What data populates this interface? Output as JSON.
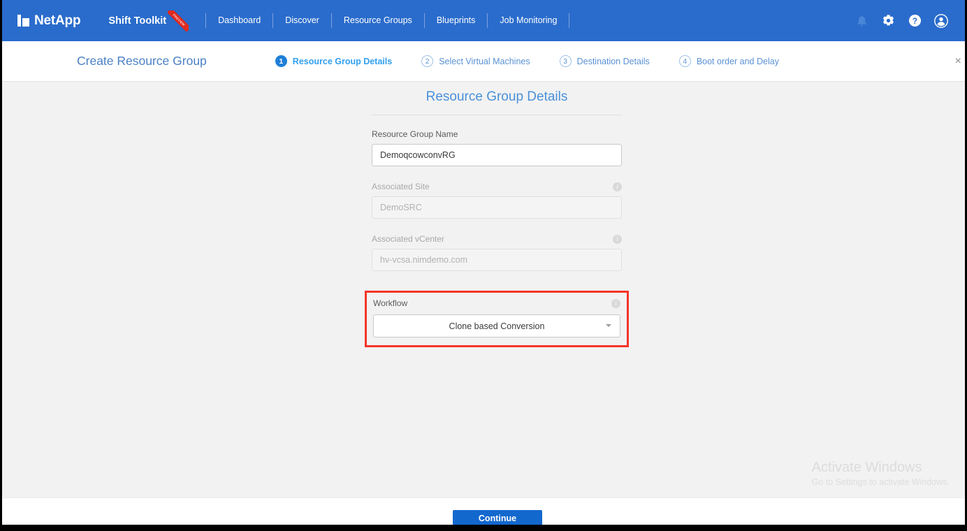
{
  "topnav": {
    "brand": "NetApp",
    "product": "Shift Toolkit",
    "ribbon_text": "PREVIEW",
    "links": [
      {
        "label": "Dashboard"
      },
      {
        "label": "Discover"
      },
      {
        "label": "Resource Groups"
      },
      {
        "label": "Blueprints"
      },
      {
        "label": "Job Monitoring"
      }
    ],
    "icons": [
      {
        "name": "bell-icon"
      },
      {
        "name": "gear-icon"
      },
      {
        "name": "help-icon"
      },
      {
        "name": "user-avatar-icon"
      }
    ],
    "background_color": "#2a6ccc"
  },
  "wizard": {
    "title": "Create Resource Group",
    "close_label": "×",
    "steps": [
      {
        "num": "1",
        "label": "Resource Group Details",
        "state": "active"
      },
      {
        "num": "2",
        "label": "Select Virtual Machines",
        "state": "idle"
      },
      {
        "num": "3",
        "label": "Destination Details",
        "state": "idle"
      },
      {
        "num": "4",
        "label": "Boot order and Delay",
        "state": "idle"
      }
    ],
    "active_color": "#31a0f0",
    "idle_color": "#5b92d4"
  },
  "form": {
    "panel_title": "Resource Group Details",
    "resource_group_name": {
      "label": "Resource Group Name",
      "value": "DemoqcowconvRG",
      "placeholder": "Resource Group Name"
    },
    "associated_site": {
      "label": "Associated Site",
      "value": "DemoSRC"
    },
    "associated_vcenter": {
      "label": "Associated vCenter",
      "value": "hv-vcsa.nimdemo.com"
    },
    "workflow": {
      "label": "Workflow",
      "value": "Clone based Conversion",
      "highlight_color": "#f5342a"
    },
    "info_glyph": "i"
  },
  "footer": {
    "continue_label": "Continue",
    "button_color": "#1368ce"
  },
  "watermark": {
    "title": "Activate Windows",
    "subtitle": "Go to Settings to activate Windows."
  }
}
